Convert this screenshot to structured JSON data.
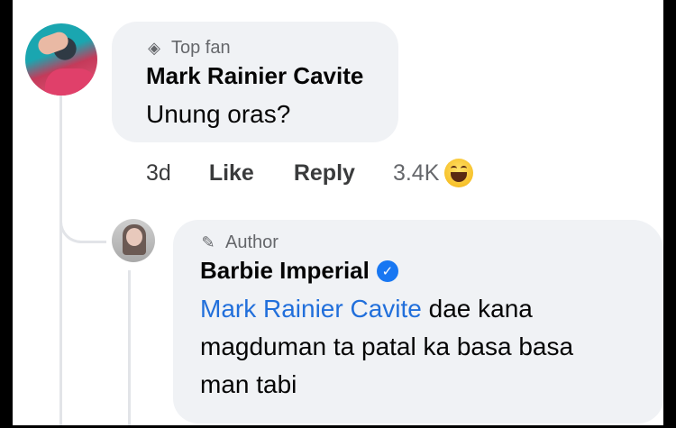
{
  "comment": {
    "badge": "Top fan",
    "badge_icon": "diamond-icon",
    "author": "Mark Rainier Cavite",
    "text": "Unung oras?",
    "actions": {
      "time": "3d",
      "like": "Like",
      "reply": "Reply",
      "reaction_count": "3.4K",
      "reaction_icon": "haha-emoji-icon"
    }
  },
  "reply": {
    "badge": "Author",
    "badge_icon": "pencil-icon",
    "author": "Barbie Imperial",
    "verified": true,
    "mention": "Mark Rainier Cavite",
    "text_line1_rest": " dae kana",
    "text_line2": "magduman ta patal ka basa basa",
    "text_line3": "man tabi"
  },
  "colors": {
    "bubble": "#f0f2f5",
    "mention": "#216fdb",
    "verified": "#1877f2"
  }
}
